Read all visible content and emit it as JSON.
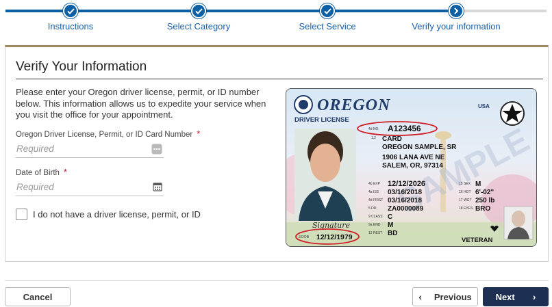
{
  "stepper": {
    "steps": [
      {
        "label": "Instructions",
        "state": "complete"
      },
      {
        "label": "Select Category",
        "state": "complete"
      },
      {
        "label": "Select Service",
        "state": "complete"
      },
      {
        "label": "Verify your information",
        "state": "current"
      }
    ],
    "colors": {
      "active": "#0b5fa5",
      "inactive": "#d9d9d9"
    }
  },
  "form": {
    "title": "Verify Your Information",
    "intro": "Please enter your Oregon driver license, permit, or ID number below. This information allows us to expedite your service when you visit the office for your appointment.",
    "license_field": {
      "label": "Oregon Driver License, Permit, or ID Card Number",
      "required_mark": "*",
      "placeholder": "Required",
      "icon": "id-card-icon"
    },
    "dob_field": {
      "label": "Date of Birth",
      "required_mark": "*",
      "placeholder": "Required",
      "icon": "calendar-icon"
    },
    "no_license_checkbox": {
      "label": "I do not have a driver license, permit, or ID",
      "checked": false
    }
  },
  "license_card": {
    "state": "OREGON",
    "type": "DRIVER LICENSE",
    "country": "USA",
    "dl_no_label": "4d NO.",
    "dl_no": "A123456",
    "class_prefix": "1,2",
    "name_line1": "CARD",
    "name_line2": "OREGON SAMPLE, SR",
    "address_line1": "1906 LANA AVE NE",
    "address_line2": "SALEM, OR, 97314",
    "exp_label": "4b EXP",
    "exp": "12/12/2026",
    "iss_label": "4a ISS",
    "iss": "03/16/2018",
    "first_label": "4d FIRST",
    "first": "03/16/2018",
    "dd_label": "5 DD",
    "dd": "ZA0000089",
    "class_label": "9 CLASS",
    "class": "C",
    "end_label": "9a END",
    "end": "M",
    "rest_label": "12 REST",
    "rest": "BD",
    "sex_label": "15 SEX",
    "sex": "M",
    "hgt_label": "16 HGT",
    "hgt": "6'-02\"",
    "wgt_label": "17 WGT",
    "wgt": "250 lb",
    "eyes_label": "18 EYES",
    "eyes": "BRO",
    "dob_label": "3 DOB",
    "dob": "12/12/1979",
    "veteran": "VETERAN",
    "watermark": "SAMPLE",
    "signature": "Signature",
    "highlight_color": "#d0202a"
  },
  "footer": {
    "cancel": "Cancel",
    "previous": "Previous",
    "next": "Next",
    "next_color": "#1d2f52"
  }
}
